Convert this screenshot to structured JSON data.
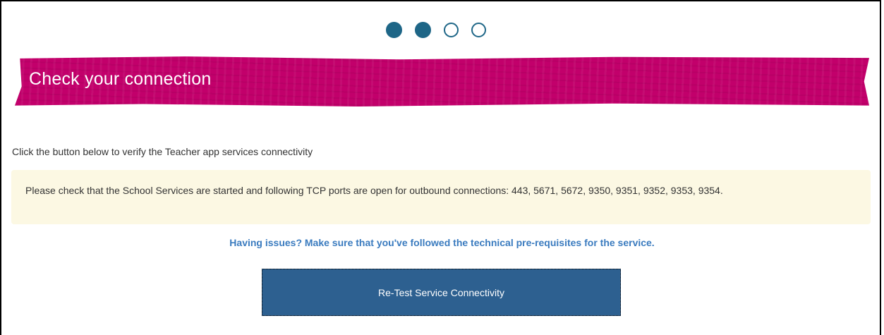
{
  "steps": {
    "total": 4,
    "completed": 2
  },
  "banner": {
    "title": "Check your connection",
    "color": "#c2006b"
  },
  "content": {
    "intro": "Click the button below to verify the Teacher app services connectivity",
    "notice": "Please check that the School Services are started and following TCP ports are open for outbound connections: 443, 5671, 5672, 9350, 9351, 9352, 9353, 9354.",
    "help_link": "Having issues? Make sure that you've followed the technical pre-requisites for the service."
  },
  "actions": {
    "retest_label": "Re-Test Service Connectivity"
  },
  "colors": {
    "accent": "#1e6687",
    "button": "#2d6090",
    "link": "#3a7bbf",
    "notice_bg": "#fcf8e3"
  }
}
